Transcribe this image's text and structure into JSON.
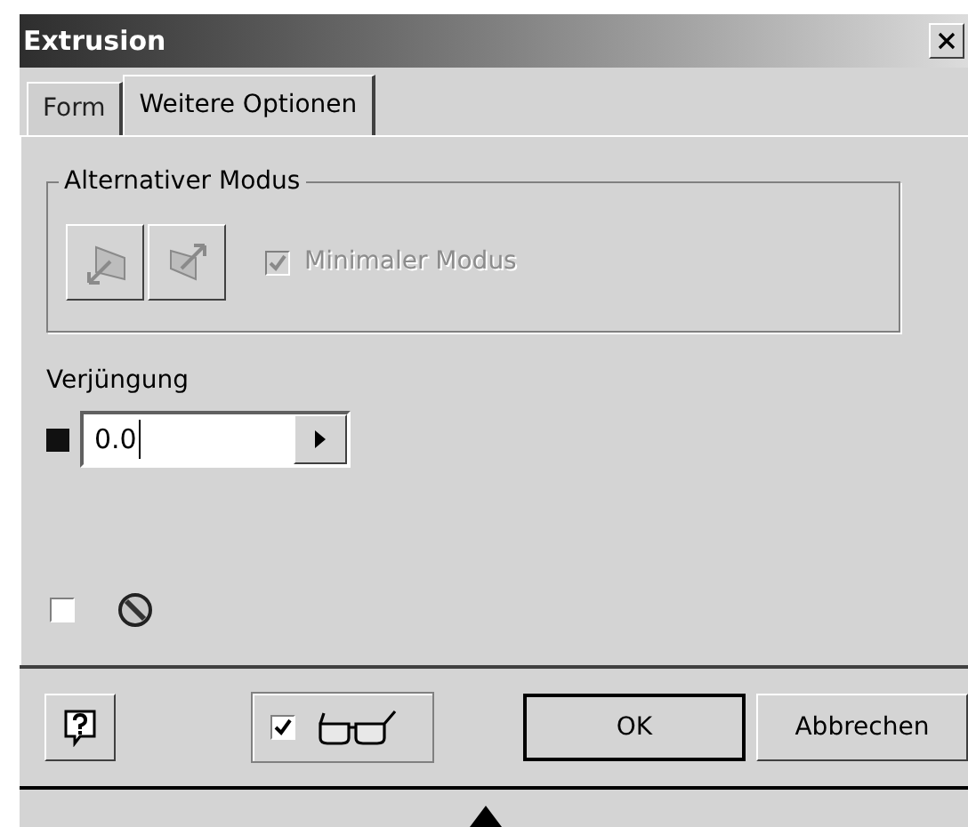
{
  "window": {
    "title": "Extrusion"
  },
  "tabs": [
    {
      "label": "Form",
      "selected": false
    },
    {
      "label": "Weitere Optionen",
      "selected": true
    }
  ],
  "alternative_mode": {
    "title": "Alternativer Modus",
    "minimal_mode": {
      "label": "Minimaler Modus",
      "checked": true,
      "disabled": true
    }
  },
  "taper": {
    "label": "Verjüngung",
    "value": "0.0"
  },
  "option_checkbox": {
    "checked": false
  },
  "footer": {
    "preview": {
      "checked": true
    },
    "buttons": [
      "OK",
      "Abbrechen"
    ]
  }
}
